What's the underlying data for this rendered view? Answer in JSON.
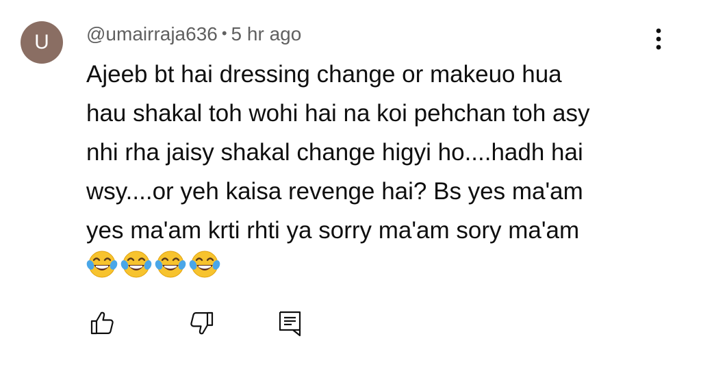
{
  "comment": {
    "avatar_letter": "U",
    "avatar_color": "#8a6e63",
    "author": "@umairraja636",
    "separator": "•",
    "timestamp": "5 hr ago",
    "text": "Ajeeb bt hai dressing change or makeuo hua\nhau shakal toh wohi hai na koi pehchan toh asy\nnhi rha jaisy shakal change higyi ho....hadh hai\nwsy....or yeh kaisa revenge hai? Bs yes ma'am\nyes ma'am  krti rhti ya sorry ma'am  sory ma'am",
    "emojis": [
      "face-with-tears-of-joy",
      "face-with-tears-of-joy",
      "face-with-tears-of-joy",
      "face-with-tears-of-joy"
    ]
  },
  "actions": {
    "like_icon": "thumbs-up-icon",
    "dislike_icon": "thumbs-down-icon",
    "reply_icon": "comment-reply-icon",
    "more_icon": "vertical-ellipsis-icon"
  },
  "colors": {
    "text": "#0f0f0f",
    "meta": "#606060",
    "icon": "#0f0f0f"
  }
}
